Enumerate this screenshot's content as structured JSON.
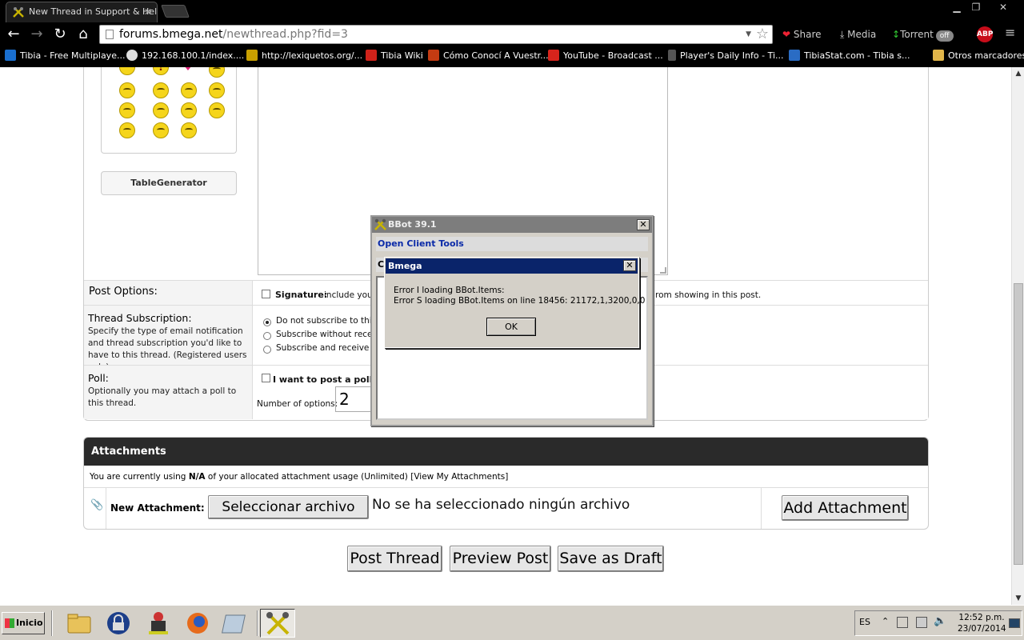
{
  "browser": {
    "tab_title": "New Thread in Support & Hel",
    "url_host": "forums.bmega.net",
    "url_path": "/newthread.php?fid=3",
    "extensions": {
      "share": "Share",
      "media": "Media",
      "torrent": "Torrent",
      "torrent_state": "off",
      "abp": "ABP"
    }
  },
  "bookmarks": [
    {
      "label": "Tibia - Free Multiplaye...",
      "color": "#1a6fcf"
    },
    {
      "label": "192.168.100.1/index....",
      "color": "#dddddd"
    },
    {
      "label": "http://lexiquetos.org/...",
      "color": "#c9a000"
    },
    {
      "label": "Tibia Wiki",
      "color": "#d0221a"
    },
    {
      "label": "Cómo Conocí A Vuestr...",
      "color": "#c43b12"
    },
    {
      "label": "YouTube - Broadcast ...",
      "color": "#d8241c"
    },
    {
      "label": "Player's Daily Info - Ti...",
      "color": "#555555"
    },
    {
      "label": "TibiaStat.com - Tibia s...",
      "color": "#2a6cc4"
    },
    {
      "label": "Otros marcadores",
      "color": "#e2b64a"
    }
  ],
  "sidebar": {
    "tablegen_label": "TableGenerator"
  },
  "post_options": {
    "label": "Post Options:",
    "signature_label": "Signature:",
    "signature_text_a": "include your",
    "signature_text_b": "rom showing in this post."
  },
  "subscription": {
    "label": "Thread Subscription:",
    "desc": "Specify the type of email notification and thread subscription you'd like to have to this thread. (Registered users only)",
    "options": [
      "Do not subscribe to this",
      "Subscribe without receiv",
      "Subscribe and receive en"
    ],
    "selected_index": 0
  },
  "poll": {
    "label": "Poll:",
    "desc": "Optionally you may attach a poll to this thread.",
    "checkbox_label": "I want to post a poll",
    "options_label": "Number of options:",
    "options_value": "2"
  },
  "attachments": {
    "header": "Attachments",
    "usage_pre": "You are currently using",
    "usage_value": "N/A",
    "usage_post": "of your allocated attachment usage (Unlimited) [View My Attachments]",
    "new_label": "New Attachment:",
    "choose_button": "Seleccionar archivo",
    "no_file_text": "No se ha seleccionado ningún archivo",
    "add_button": "Add Attachment"
  },
  "actions": {
    "post": "Post Thread",
    "preview": "Preview Post",
    "draft": "Save as Draft"
  },
  "bbot": {
    "title": "BBot 39.1",
    "menu": "Open Client Tools",
    "menu2": "Cl"
  },
  "dialog": {
    "title": "Bmega",
    "line1": "Error I loading BBot.Items:",
    "line2": "Error S loading BBot.Items on line 18456: 21172,1,3200,0,0",
    "ok": "OK"
  },
  "taskbar": {
    "start": "Inicio",
    "lang": "ES",
    "time": "12:52 p.m.",
    "date": "23/07/2014"
  }
}
